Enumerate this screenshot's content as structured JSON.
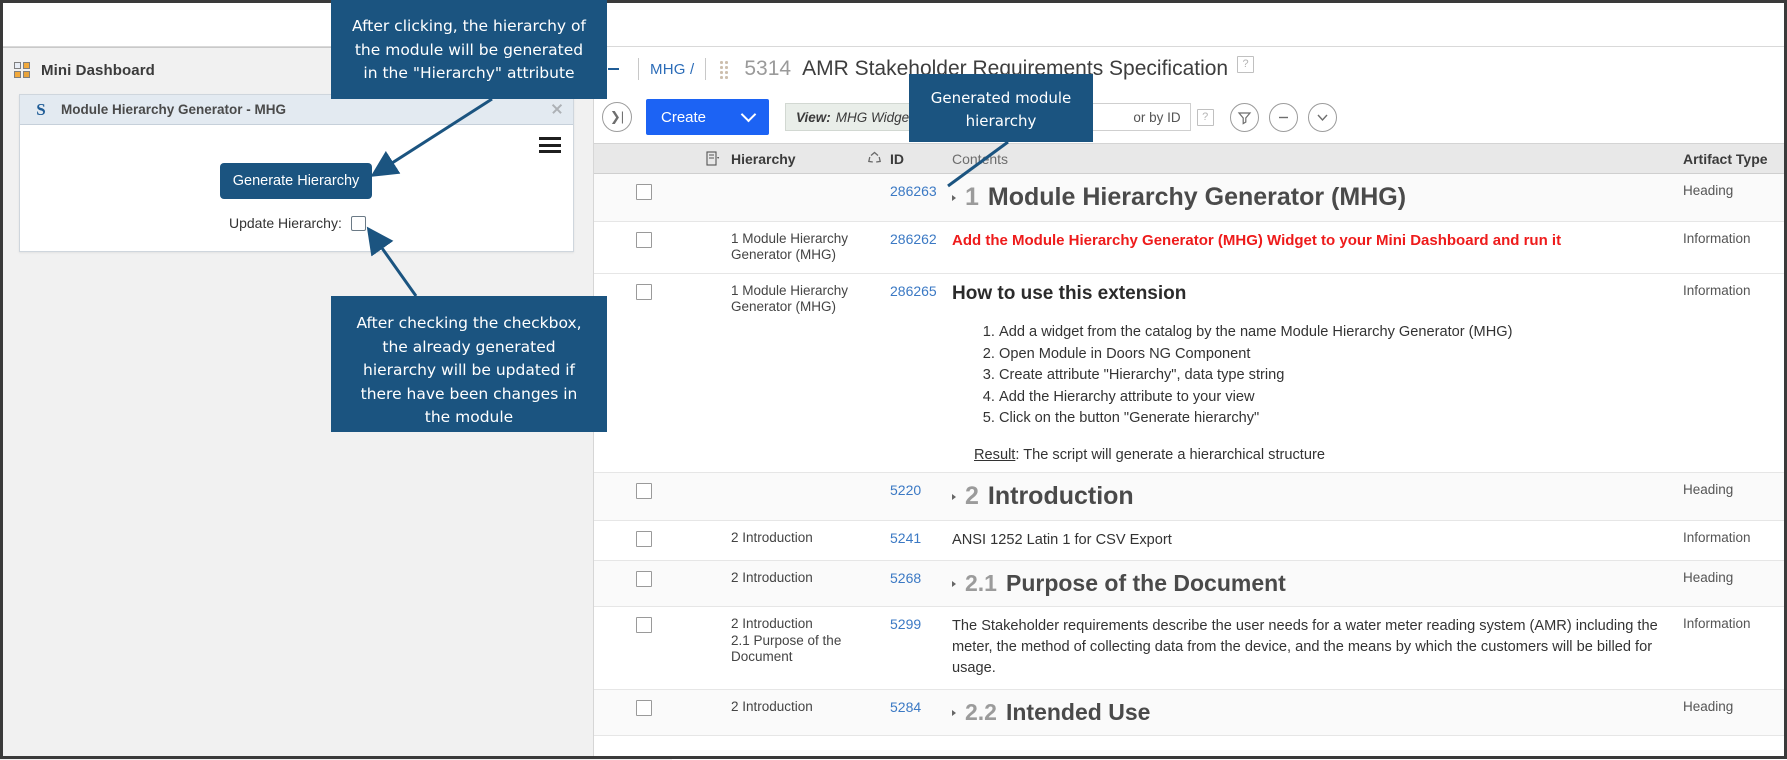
{
  "widget": {
    "mini_dashboard_label": "Mini Dashboard",
    "card_title": "Module Hierarchy Generator - MHG",
    "generate_button": "Generate Hierarchy",
    "update_label": "Update Hierarchy:"
  },
  "callouts": {
    "top": "After clicking, the hierarchy of the module will be generated in the \"Hierarchy\" attribute",
    "update": "After checking the checkbox, the already generated hierarchy will be updated if there have been changes in the module",
    "hierarchy": "Generated module hierarchy"
  },
  "breadcrumb": {
    "project": "MHG /",
    "artifact_id": "5314",
    "artifact_title": "AMR Stakeholder Requirements Specification"
  },
  "toolbar": {
    "create_label": "Create",
    "view_prefix": "View:",
    "view_value": "MHG Widget View",
    "search_placeholder": "or by ID"
  },
  "table": {
    "headers": {
      "hierarchy": "Hierarchy",
      "id": "ID",
      "contents": "Contents",
      "artifact_type": "Artifact Type"
    },
    "rows": [
      {
        "hierarchy": "",
        "id": "286263",
        "type": "Heading",
        "kind": "heading1",
        "number": "1",
        "text": "Module Hierarchy Generator (MHG)"
      },
      {
        "hierarchy": "1 Module Hierarchy Generator (MHG)",
        "id": "286262",
        "type": "Information",
        "kind": "red",
        "text": "Add the Module Hierarchy Generator (MHG) Widget to your Mini Dashboard and run it"
      },
      {
        "hierarchy": "1 Module Hierarchy Generator (MHG)",
        "id": "286265",
        "type": "Information",
        "kind": "howto",
        "title": "How to use this extension",
        "steps": [
          "Add a widget from the catalog by the name Module Hierarchy Generator (MHG)",
          "Open Module in Doors NG Component",
          "Create attribute \"Hierarchy\", data type string",
          "Add the Hierarchy attribute to your view",
          "Click on the button \"Generate hierarchy\""
        ],
        "result_label": "Result",
        "result_text": ": The script will generate a hierarchical structure"
      },
      {
        "hierarchy": "",
        "id": "5220",
        "type": "Heading",
        "kind": "heading1",
        "number": "2",
        "text": "Introduction"
      },
      {
        "hierarchy": "2 Introduction",
        "id": "5241",
        "type": "Information",
        "kind": "plain",
        "text": "ANSI 1252 Latin 1 for CSV Export"
      },
      {
        "hierarchy": "2 Introduction",
        "id": "5268",
        "type": "Heading",
        "kind": "heading2",
        "number": "2.1",
        "text": "Purpose of the Document"
      },
      {
        "hierarchy": "2 Introduction\n2.1 Purpose of the Document",
        "id": "5299",
        "type": "Information",
        "kind": "para",
        "text": "The Stakeholder requirements describe the user needs for a water meter reading system (AMR) including the meter, the method of collecting data from the device, and the means by which the customers will be billed for usage."
      },
      {
        "hierarchy": "2 Introduction",
        "id": "5284",
        "type": "Heading",
        "kind": "heading2",
        "number": "2.2",
        "text": "Intended Use"
      }
    ]
  },
  "colors": {
    "callout_bg": "#1b5480",
    "create_blue": "#1c63f4",
    "link_blue": "#3b79c4",
    "red": "#ee1b1b"
  }
}
